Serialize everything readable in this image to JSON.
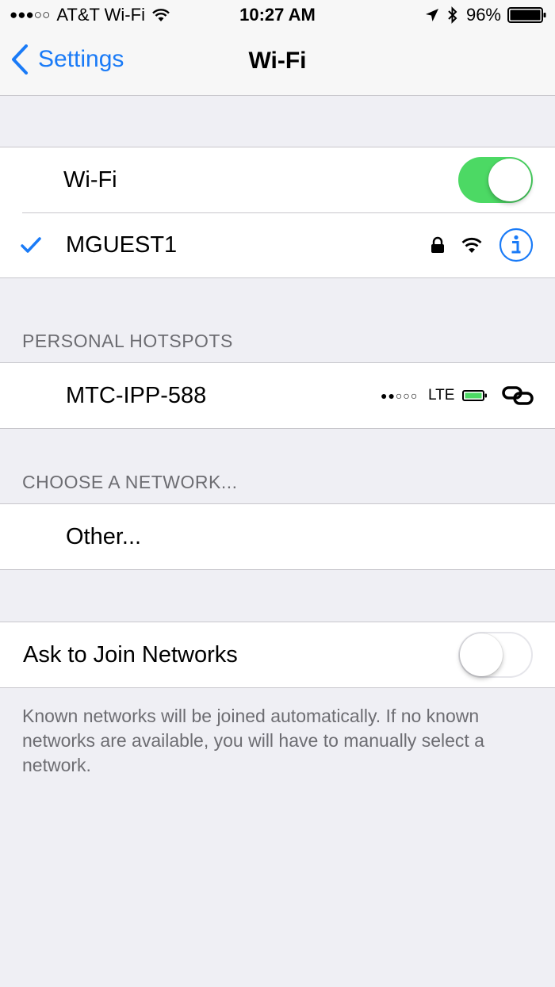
{
  "status_bar": {
    "signal": "●●●○○",
    "carrier": "AT&T Wi-Fi",
    "time": "10:27 AM",
    "battery": "96%"
  },
  "nav": {
    "back_label": "Settings",
    "title": "Wi-Fi"
  },
  "wifi": {
    "label": "Wi-Fi",
    "enabled": true,
    "connected_network": "MGUEST1"
  },
  "personal_hotspots": {
    "header": "PERSONAL HOTSPOTS",
    "items": [
      {
        "name": "MTC-IPP-588",
        "signal": "●●○○○",
        "network_type": "LTE"
      }
    ]
  },
  "choose_network": {
    "header": "CHOOSE A NETWORK...",
    "other_label": "Other..."
  },
  "ask_to_join": {
    "label": "Ask to Join Networks",
    "enabled": false,
    "footer": "Known networks will be joined automatically. If no known networks are available, you will have to manually select a network."
  },
  "colors": {
    "accent": "#1a7bf7",
    "toggle_on": "#4cd964",
    "background": "#efeff4"
  }
}
